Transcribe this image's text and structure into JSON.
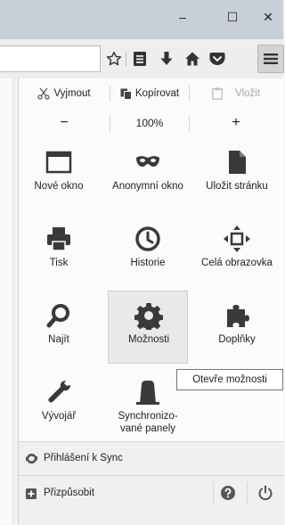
{
  "window": {
    "minimize_glyph": "–",
    "maximize_glyph": "☐",
    "close_glyph": "✕"
  },
  "toolbar": {
    "icons": [
      "star-icon",
      "reading-list-icon",
      "download-icon",
      "home-icon",
      "pocket-icon",
      "hamburger-menu-icon"
    ]
  },
  "menu": {
    "edit": {
      "cut": "Vyjmout",
      "copy": "Kopírovat",
      "paste": "Vložit"
    },
    "zoom": {
      "minus": "−",
      "level": "100%",
      "plus": "+"
    },
    "items": [
      {
        "label": "Nové okno",
        "icon": "new-window-icon"
      },
      {
        "label": "Anonymní okno",
        "icon": "private-mask-icon"
      },
      {
        "label": "Uložit stránku",
        "icon": "save-page-icon"
      },
      {
        "label": "Tisk",
        "icon": "print-icon"
      },
      {
        "label": "Historie",
        "icon": "history-clock-icon"
      },
      {
        "label": "Celá obrazovka",
        "icon": "fullscreen-icon"
      },
      {
        "label": "Najít",
        "icon": "find-magnifier-icon"
      },
      {
        "label": "Možnosti",
        "icon": "options-gear-icon"
      },
      {
        "label": "Doplňky",
        "icon": "addons-puzzle-icon"
      },
      {
        "label": "Vývojář",
        "icon": "developer-wrench-icon"
      },
      {
        "label": "Synchronizo-vané panely",
        "icon": "synced-tabs-icon"
      }
    ],
    "tooltip": "Otevře možnosti",
    "sync_label": "Přihlášení k Sync",
    "customize_label": "Přizpůsobit"
  },
  "colors": {
    "accent_icon": "#3a3a3a",
    "titlebar": "#c9cfd6",
    "panel": "#fbfbfb"
  }
}
